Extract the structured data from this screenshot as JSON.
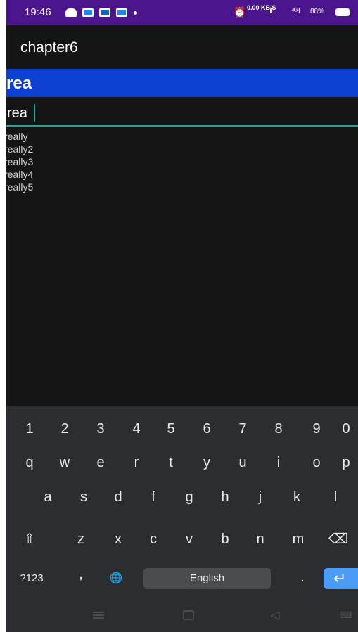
{
  "status_bar": {
    "time": "19:46",
    "speed": "0.00 KB/S",
    "signal1": ".ıl",
    "signal2": "⁴ᴳıl",
    "battery": "88%",
    "icons": [
      "messages-icon",
      "app-icon",
      "facebook-icon",
      "app-icon",
      "notification-dot",
      "alarm-icon",
      "signal-icon",
      "battery-icon"
    ]
  },
  "app_bar": {
    "title": "chapter6"
  },
  "header": {
    "text": "rea"
  },
  "search": {
    "value": "rea"
  },
  "suggestions": [
    "really",
    "really2",
    "really3",
    "really4",
    "really5"
  ],
  "keyboard": {
    "row_numbers": [
      "1",
      "2",
      "3",
      "4",
      "5",
      "6",
      "7",
      "8",
      "9",
      "0"
    ],
    "row_1": [
      "q",
      "w",
      "e",
      "r",
      "t",
      "y",
      "u",
      "i",
      "o",
      "p"
    ],
    "row_2": [
      "a",
      "s",
      "d",
      "f",
      "g",
      "h",
      "j",
      "k",
      "l"
    ],
    "row_3": [
      "z",
      "x",
      "c",
      "v",
      "b",
      "n",
      "m"
    ],
    "symbols_label": "?123",
    "comma_label": ",",
    "space_label": "English",
    "period_label": ".",
    "shift_icon": "⇧",
    "backspace_icon": "⌫",
    "globe_icon": "🌐",
    "enter_icon": "↵"
  },
  "colors": {
    "status_bar": "#4a148c",
    "header": "#0d3fd0",
    "input_underline": "#26a69a",
    "enter_key": "#4b9cf5"
  }
}
